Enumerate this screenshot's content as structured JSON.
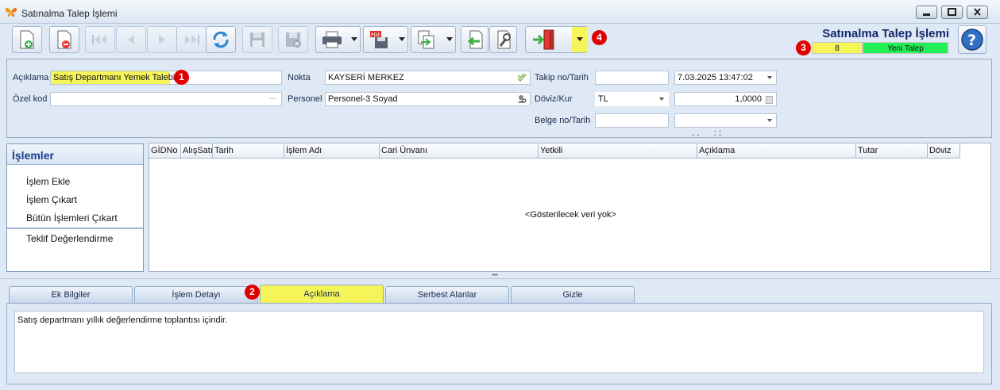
{
  "window": {
    "title": "Satınalma Talep İşlemi"
  },
  "header": {
    "form_title": "Satınalma Talep İşlemi",
    "status_number": "8",
    "status_text": "Yeni Talep"
  },
  "badges": [
    "1",
    "2",
    "3",
    "4"
  ],
  "form": {
    "aciklama_label": "Açıklama",
    "aciklama_value": "Satış Departmanı Yemek Talebi",
    "ozel_kod_label": "Özel kod",
    "ozel_kod_value": "",
    "nokta_label": "Nokta",
    "nokta_value": "KAYSERİ MERKEZ",
    "personel_label": "Personel",
    "personel_value": "Personel-3 Soyad",
    "takip_label": "Takip no/Tarih",
    "takip_no": "",
    "takip_tarih": "7.03.2025 13:47:02",
    "doviz_label": "Döviz/Kur",
    "doviz_value": "TL",
    "kur_value": "1,0000",
    "belge_label": "Belge no/Tarih",
    "belge_no": "",
    "belge_tarih": ". .      : :",
    "ellipsis": "···"
  },
  "side_panel": {
    "title": "İşlemler",
    "items": [
      "İşlem Ekle",
      "İşlem Çıkart",
      "Bütün İşlemleri Çıkart"
    ],
    "extra_item": "Teklif Değerlendirme"
  },
  "grid": {
    "columns": [
      "GİDNo",
      "AlışSatış",
      "Tarih",
      "İşlem Adı",
      "Cari Ünvanı",
      "Yetkili",
      "Açıklama",
      "Tutar",
      "Döviz"
    ],
    "empty_text": "<Gösterilecek veri yok>"
  },
  "splitter": "•••••",
  "tabs": [
    "Ek Bilgiler",
    "İşlem Detayı",
    "Açıklama",
    "Serbest Alanlar",
    "Gizle"
  ],
  "active_tab": "Açıklama",
  "note": "Satış departmanı yıllık değerlendirme toplantısı içindir.",
  "colors": {
    "highlight": "#f5f55a",
    "status_green": "#22ee55",
    "badge_red": "#e00000",
    "title_blue": "#14286b"
  }
}
